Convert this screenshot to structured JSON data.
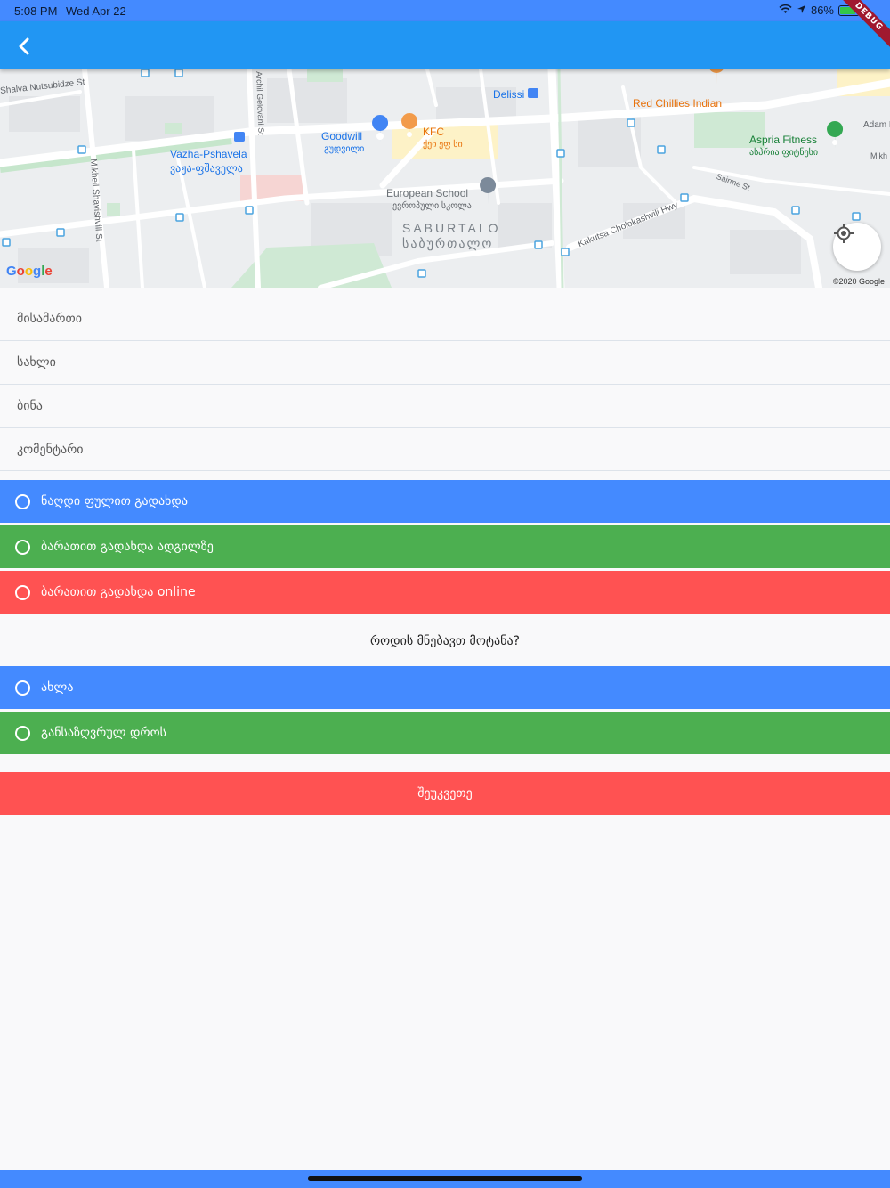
{
  "status_bar": {
    "time": "5:08 PM",
    "date": "Wed Apr 22",
    "battery": "86%",
    "battery_level": 0.86,
    "debug_banner": "DEBUG"
  },
  "app_bar": {
    "back_icon": "chevron-left-icon",
    "color": "#2196f3"
  },
  "map": {
    "labels": {
      "shalva": "Shalva Nutsubidze St",
      "delissi": "Delissi",
      "red_chillies": "Red Chillies Indian",
      "adam": "Adam M",
      "goodwill": "Goodwill",
      "goodwill_ka": "გუდვილი",
      "kfc": "KFC",
      "kfc_ka": "ქეი ეფ სი",
      "aspria": "Aspria Fitness",
      "aspria_ka": "ასპრია ფიტნესი",
      "vazha": "Vazha-Pshavela",
      "vazha_ka": "ვაჟა-ფშაველა",
      "archil": "Archil Gelovani St",
      "mikheil": "Mikheil Shavishvili St",
      "european": "European School",
      "european_ka": "ევროპული სკოლა",
      "saburtalo": "SABURTALO",
      "saburtalo_ka": "საბურთალო",
      "kakutsa": "Kakutsa Cholokashvili Hwy",
      "sairme": "Sairme St",
      "mikh": "Mikh"
    },
    "google_logo": "Google",
    "copyright": "©2020 Google",
    "locate_icon": "my-location-icon"
  },
  "form": {
    "address_placeholder": "მისამართი",
    "house_placeholder": "სახლი",
    "apartment_placeholder": "ბინა",
    "comment_placeholder": "კომენტარი"
  },
  "payment_options": [
    {
      "label": "ნაღდი ფულით გადახდა",
      "color": "#448aff"
    },
    {
      "label": "ბარათით გადახდა ადგილზე",
      "color": "#4caf50"
    },
    {
      "label": "ბარათით გადახდა online",
      "color": "#ff5252"
    }
  ],
  "delivery_question": "როდის მნებავთ მოტანა?",
  "delivery_options": [
    {
      "label": "ახლა",
      "color": "#448aff"
    },
    {
      "label": "განსაზღვრულ დროს",
      "color": "#4caf50"
    }
  ],
  "submit_label": "შეუკვეთე"
}
